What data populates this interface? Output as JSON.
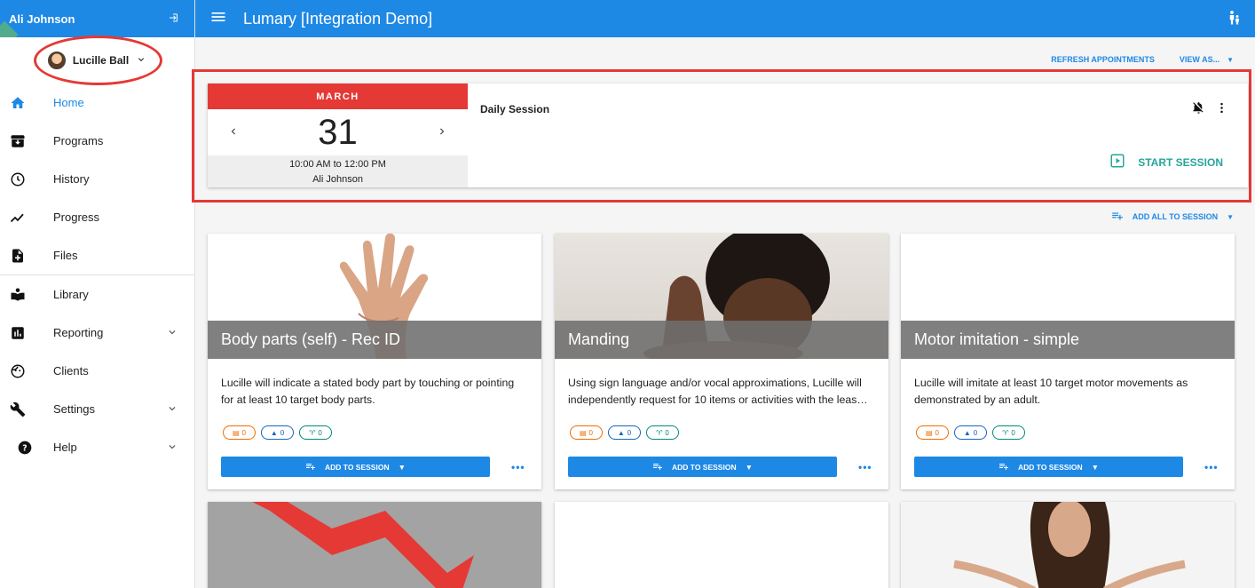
{
  "sidebar": {
    "user_name": "Ali Johnson",
    "client_name": "Lucille Ball",
    "items": [
      {
        "label": "Home",
        "icon": "home-icon"
      },
      {
        "label": "Programs",
        "icon": "archive-icon"
      },
      {
        "label": "History",
        "icon": "clock-icon"
      },
      {
        "label": "Progress",
        "icon": "trend-icon"
      },
      {
        "label": "Files",
        "icon": "file-add-icon"
      },
      {
        "label": "Library",
        "icon": "book-icon"
      },
      {
        "label": "Reporting",
        "icon": "chart-icon"
      },
      {
        "label": "Clients",
        "icon": "face-icon"
      },
      {
        "label": "Settings",
        "icon": "wrench-icon"
      },
      {
        "label": "Help",
        "icon": "help-icon"
      }
    ]
  },
  "header": {
    "title": "Lumary [Integration Demo]"
  },
  "toolbar": {
    "refresh_label": "REFRESH APPOINTMENTS",
    "view_as_label": "VIEW AS..."
  },
  "appointment": {
    "month": "MARCH",
    "day": "31",
    "time": "10:00 AM to 12:00 PM",
    "staff": "Ali Johnson",
    "session_name": "Daily Session",
    "start_label": "START SESSION"
  },
  "add_all_label": "ADD ALL TO SESSION",
  "cards": [
    {
      "title": "Body parts (self) - Rec ID",
      "description": "Lucille will indicate a stated body part by touching or pointing for at least 10 target body parts.",
      "badges": [
        "0",
        "0",
        "0"
      ],
      "add_label": "ADD TO SESSION"
    },
    {
      "title": "Manding",
      "description": "Using sign language and/or vocal approximations, Lucille will independently request for 10 items or activities with the leas…",
      "badges": [
        "0",
        "0",
        "0"
      ],
      "add_label": "ADD TO SESSION"
    },
    {
      "title": "Motor imitation - simple",
      "description": "Lucille will imitate at least 10 target motor movements as demonstrated by an adult.",
      "badges": [
        "0",
        "0",
        "0"
      ],
      "add_label": "ADD TO SESSION"
    }
  ],
  "colors": {
    "primary": "#1e88e5",
    "danger": "#e53935",
    "teal": "#26a69a"
  }
}
